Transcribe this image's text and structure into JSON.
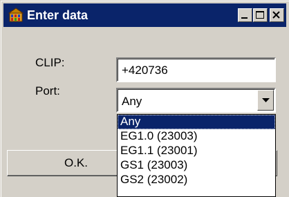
{
  "window": {
    "title": "Enter data",
    "icon": "app-icon",
    "controls": [
      "minimize-icon",
      "maximize-icon",
      "close-icon"
    ]
  },
  "form": {
    "clip_label": "CLIP:",
    "clip_value": "+420736",
    "port_label": "Port:",
    "port_value": "Any"
  },
  "buttons": {
    "ok_label": "O.K."
  },
  "dropdown": {
    "items": [
      "Any",
      "EG1.0 (23003)",
      "EG1.1 (23001)",
      "GS1 (23003)",
      "GS2 (23002)"
    ],
    "selected": "Any"
  },
  "colors": {
    "titlebar": "#0a246a",
    "face": "#d4d0c8",
    "selection": "#0a246a"
  }
}
